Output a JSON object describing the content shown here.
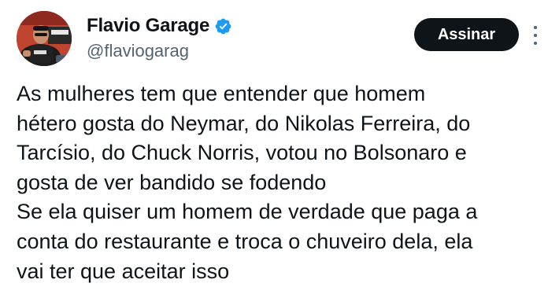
{
  "author": {
    "display_name": "Flavio Garage",
    "handle": "@flaviogarag",
    "verified": true
  },
  "subscribe_button": {
    "label": "Assinar"
  },
  "tweet": {
    "lines": [
      "As mulheres tem que entender que homem",
      "hétero gosta do Neymar, do Nikolas Ferreira, do",
      "Tarcísio, do Chuck Norris, votou no Bolsonaro e",
      "gosta de ver bandido se fodendo",
      "Se ela quiser um homem de verdade que paga a",
      "conta do restaurante e troca o chuveiro dela, ela",
      "vai ter que aceitar isso"
    ]
  },
  "colors": {
    "verified_badge": "#1d9bf0",
    "subscribe_button_bg": "#0f1419",
    "text_primary": "#0f1419",
    "text_secondary": "#536471"
  },
  "icons": {
    "verified": "verified-badge-icon",
    "more": "more-options-icon"
  }
}
